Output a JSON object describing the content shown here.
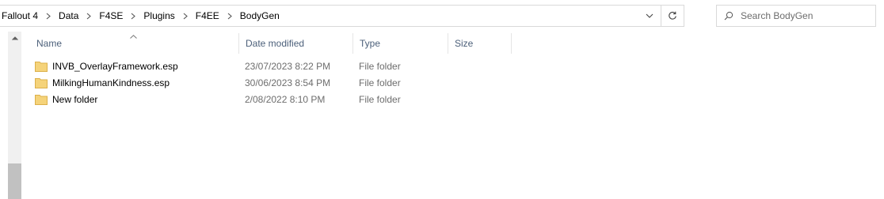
{
  "address": {
    "crumbs": [
      "Fallout 4",
      "Data",
      "F4SE",
      "Plugins",
      "F4EE",
      "BodyGen"
    ]
  },
  "search": {
    "placeholder": "Search BodyGen"
  },
  "columns": {
    "name": "Name",
    "date": "Date modified",
    "type": "Type",
    "size": "Size"
  },
  "files": [
    {
      "name": "INVB_OverlayFramework.esp",
      "date": "23/07/2023 8:22 PM",
      "type": "File folder"
    },
    {
      "name": "MilkingHumanKindness.esp",
      "date": "30/06/2023 8:54 PM",
      "type": "File folder"
    },
    {
      "name": "New folder",
      "date": "2/08/2022 8:10 PM",
      "type": "File folder"
    }
  ],
  "icons": {
    "folder_color": "#f5d37a",
    "folder_edge": "#dcb04a"
  }
}
